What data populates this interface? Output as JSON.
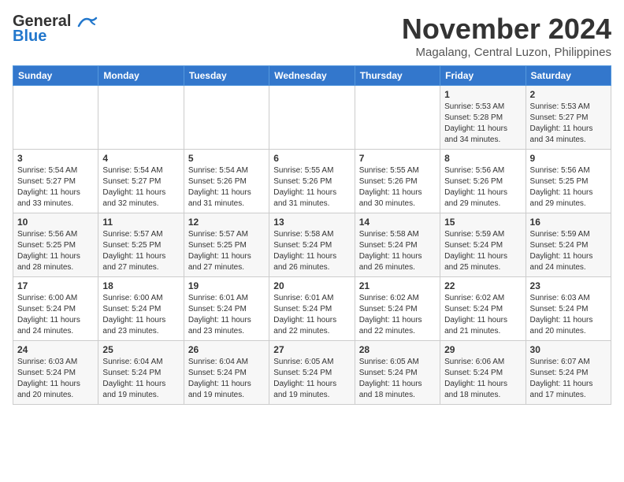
{
  "header": {
    "logo_line1": "General",
    "logo_line2": "Blue",
    "month": "November 2024",
    "location": "Magalang, Central Luzon, Philippines"
  },
  "weekdays": [
    "Sunday",
    "Monday",
    "Tuesday",
    "Wednesday",
    "Thursday",
    "Friday",
    "Saturday"
  ],
  "weeks": [
    [
      {
        "day": "",
        "info": ""
      },
      {
        "day": "",
        "info": ""
      },
      {
        "day": "",
        "info": ""
      },
      {
        "day": "",
        "info": ""
      },
      {
        "day": "",
        "info": ""
      },
      {
        "day": "1",
        "info": "Sunrise: 5:53 AM\nSunset: 5:28 PM\nDaylight: 11 hours\nand 34 minutes."
      },
      {
        "day": "2",
        "info": "Sunrise: 5:53 AM\nSunset: 5:27 PM\nDaylight: 11 hours\nand 34 minutes."
      }
    ],
    [
      {
        "day": "3",
        "info": "Sunrise: 5:54 AM\nSunset: 5:27 PM\nDaylight: 11 hours\nand 33 minutes."
      },
      {
        "day": "4",
        "info": "Sunrise: 5:54 AM\nSunset: 5:27 PM\nDaylight: 11 hours\nand 32 minutes."
      },
      {
        "day": "5",
        "info": "Sunrise: 5:54 AM\nSunset: 5:26 PM\nDaylight: 11 hours\nand 31 minutes."
      },
      {
        "day": "6",
        "info": "Sunrise: 5:55 AM\nSunset: 5:26 PM\nDaylight: 11 hours\nand 31 minutes."
      },
      {
        "day": "7",
        "info": "Sunrise: 5:55 AM\nSunset: 5:26 PM\nDaylight: 11 hours\nand 30 minutes."
      },
      {
        "day": "8",
        "info": "Sunrise: 5:56 AM\nSunset: 5:26 PM\nDaylight: 11 hours\nand 29 minutes."
      },
      {
        "day": "9",
        "info": "Sunrise: 5:56 AM\nSunset: 5:25 PM\nDaylight: 11 hours\nand 29 minutes."
      }
    ],
    [
      {
        "day": "10",
        "info": "Sunrise: 5:56 AM\nSunset: 5:25 PM\nDaylight: 11 hours\nand 28 minutes."
      },
      {
        "day": "11",
        "info": "Sunrise: 5:57 AM\nSunset: 5:25 PM\nDaylight: 11 hours\nand 27 minutes."
      },
      {
        "day": "12",
        "info": "Sunrise: 5:57 AM\nSunset: 5:25 PM\nDaylight: 11 hours\nand 27 minutes."
      },
      {
        "day": "13",
        "info": "Sunrise: 5:58 AM\nSunset: 5:24 PM\nDaylight: 11 hours\nand 26 minutes."
      },
      {
        "day": "14",
        "info": "Sunrise: 5:58 AM\nSunset: 5:24 PM\nDaylight: 11 hours\nand 26 minutes."
      },
      {
        "day": "15",
        "info": "Sunrise: 5:59 AM\nSunset: 5:24 PM\nDaylight: 11 hours\nand 25 minutes."
      },
      {
        "day": "16",
        "info": "Sunrise: 5:59 AM\nSunset: 5:24 PM\nDaylight: 11 hours\nand 24 minutes."
      }
    ],
    [
      {
        "day": "17",
        "info": "Sunrise: 6:00 AM\nSunset: 5:24 PM\nDaylight: 11 hours\nand 24 minutes."
      },
      {
        "day": "18",
        "info": "Sunrise: 6:00 AM\nSunset: 5:24 PM\nDaylight: 11 hours\nand 23 minutes."
      },
      {
        "day": "19",
        "info": "Sunrise: 6:01 AM\nSunset: 5:24 PM\nDaylight: 11 hours\nand 23 minutes."
      },
      {
        "day": "20",
        "info": "Sunrise: 6:01 AM\nSunset: 5:24 PM\nDaylight: 11 hours\nand 22 minutes."
      },
      {
        "day": "21",
        "info": "Sunrise: 6:02 AM\nSunset: 5:24 PM\nDaylight: 11 hours\nand 22 minutes."
      },
      {
        "day": "22",
        "info": "Sunrise: 6:02 AM\nSunset: 5:24 PM\nDaylight: 11 hours\nand 21 minutes."
      },
      {
        "day": "23",
        "info": "Sunrise: 6:03 AM\nSunset: 5:24 PM\nDaylight: 11 hours\nand 20 minutes."
      }
    ],
    [
      {
        "day": "24",
        "info": "Sunrise: 6:03 AM\nSunset: 5:24 PM\nDaylight: 11 hours\nand 20 minutes."
      },
      {
        "day": "25",
        "info": "Sunrise: 6:04 AM\nSunset: 5:24 PM\nDaylight: 11 hours\nand 19 minutes."
      },
      {
        "day": "26",
        "info": "Sunrise: 6:04 AM\nSunset: 5:24 PM\nDaylight: 11 hours\nand 19 minutes."
      },
      {
        "day": "27",
        "info": "Sunrise: 6:05 AM\nSunset: 5:24 PM\nDaylight: 11 hours\nand 19 minutes."
      },
      {
        "day": "28",
        "info": "Sunrise: 6:05 AM\nSunset: 5:24 PM\nDaylight: 11 hours\nand 18 minutes."
      },
      {
        "day": "29",
        "info": "Sunrise: 6:06 AM\nSunset: 5:24 PM\nDaylight: 11 hours\nand 18 minutes."
      },
      {
        "day": "30",
        "info": "Sunrise: 6:07 AM\nSunset: 5:24 PM\nDaylight: 11 hours\nand 17 minutes."
      }
    ]
  ]
}
